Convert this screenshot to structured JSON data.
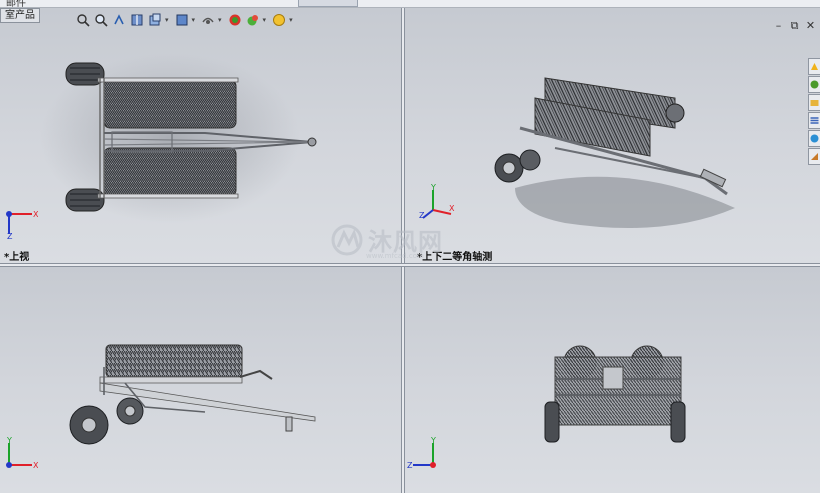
{
  "window": {
    "top_tab_label": "邮件",
    "tree_tab_label": "室产品",
    "controls": {
      "minimize": "–",
      "restore": "⧉",
      "close": "✕"
    }
  },
  "hud_toolbar": {
    "items": [
      {
        "name": "zoom-to-fit-icon"
      },
      {
        "name": "zoom-to-area-icon"
      },
      {
        "name": "previous-view-icon"
      },
      {
        "name": "section-view-icon"
      },
      {
        "name": "view-orientation-icon"
      },
      {
        "name": "display-style-icon"
      },
      {
        "name": "hide-show-items-icon"
      },
      {
        "name": "edit-appearance-icon"
      },
      {
        "name": "apply-scene-icon"
      },
      {
        "name": "view-settings-icon"
      }
    ],
    "dropdown_glyph": "▾"
  },
  "task_pane": {
    "items": [
      {
        "name": "resources-icon",
        "color": "#f0b21a"
      },
      {
        "name": "design-library-icon",
        "color": "#4a9a2a"
      },
      {
        "name": "file-explorer-icon",
        "color": "#e7b43a"
      },
      {
        "name": "view-palette-icon",
        "color": "#3b64b8"
      },
      {
        "name": "appearances-icon",
        "color": "#2b8fd4"
      },
      {
        "name": "custom-properties-icon",
        "color": "#c87a2a"
      }
    ]
  },
  "viewports": {
    "top": {
      "label": "*上视"
    },
    "iso": {
      "label": "*上下二等角轴测"
    },
    "front": {
      "label": ""
    },
    "side": {
      "label": ""
    }
  },
  "triad": {
    "x_label": "X",
    "y_label": "Y",
    "z_label": "Z",
    "x_color": "#e0202a",
    "y_color": "#1ba32a",
    "z_color": "#2338c8"
  },
  "watermark": {
    "text": "沐风网",
    "url": "www.mfcad.com"
  }
}
